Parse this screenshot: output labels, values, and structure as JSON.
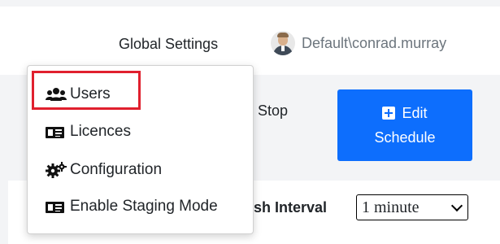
{
  "header": {
    "global_settings": "Global Settings",
    "username": "Default\\conrad.murray"
  },
  "panel": {
    "partial_text": "e Stop",
    "edit_button_line1": "Edit",
    "edit_button_line2": "Schedule",
    "refresh_label": "esh Interval",
    "refresh_value": "1 minute"
  },
  "dropdown": {
    "items": [
      {
        "label": "Users",
        "icon": "users-icon"
      },
      {
        "label": "Licences",
        "icon": "id-card-icon"
      },
      {
        "label": "Configuration",
        "icon": "cogs-icon"
      },
      {
        "label": "Enable Staging Mode",
        "icon": "id-card-icon"
      }
    ],
    "highlighted_item": "Users"
  },
  "colors": {
    "primary": "#0d6efd",
    "highlight_border": "#e0202e",
    "muted_text": "#6c757d"
  }
}
